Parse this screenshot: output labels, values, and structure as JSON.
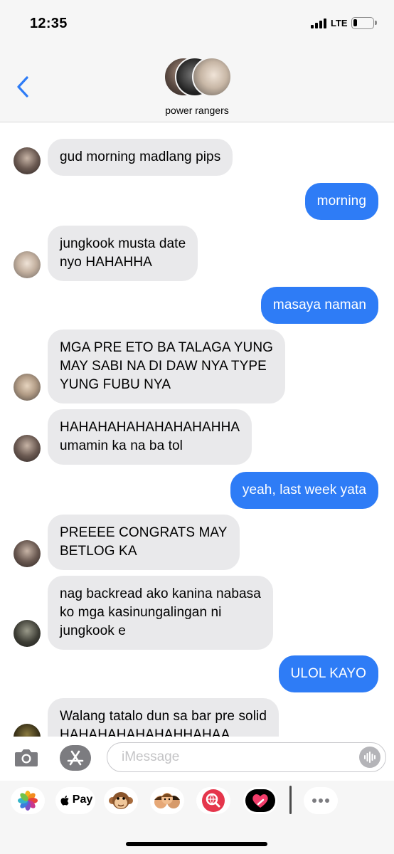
{
  "status_bar": {
    "time": "12:35",
    "network": "LTE",
    "battery_percent": 20
  },
  "header": {
    "group_name": "power rangers",
    "back_icon": "chevron-left-icon"
  },
  "messages": [
    {
      "sender": "them",
      "lines": [
        "gud morning madlang pips"
      ]
    },
    {
      "sender": "me",
      "lines": [
        "morning"
      ]
    },
    {
      "sender": "them",
      "lines": [
        "jungkook musta date",
        "nyo HAHAHHA"
      ]
    },
    {
      "sender": "me",
      "lines": [
        "masaya naman"
      ]
    },
    {
      "sender": "them",
      "lines": [
        "MGA PRE ETO BA TALAGA YUNG",
        "MAY SABI NA DI DAW NYA TYPE",
        "YUNG FUBU NYA"
      ]
    },
    {
      "sender": "them",
      "lines": [
        "HAHAHAHAHAHAHAHAHHA",
        "umamin ka na ba tol"
      ]
    },
    {
      "sender": "me",
      "lines": [
        "yeah, last week yata"
      ]
    },
    {
      "sender": "them",
      "lines": [
        "PREEEE CONGRATS MAY",
        "BETLOG KA"
      ]
    },
    {
      "sender": "them",
      "lines": [
        "nag backread ako kanina nabasa",
        "ko mga kasinungalingan ni",
        "jungkook e"
      ]
    },
    {
      "sender": "me",
      "lines": [
        "ULOL KAYO"
      ]
    },
    {
      "sender": "them",
      "lines": [
        "Walang tatalo dun sa bar pre solid",
        "HAHAHAHAHAHAHHAHAA"
      ]
    }
  ],
  "input_bar": {
    "camera_icon": "camera-icon",
    "apps_icon": "app-store-icon",
    "placeholder": "iMessage",
    "value": "",
    "audio_icon": "audio-waveform-icon"
  },
  "app_drawer": {
    "apps": [
      {
        "name": "photos-icon"
      },
      {
        "name": "apple-pay",
        "label": "Pay"
      },
      {
        "name": "monkey-emoji-icon"
      },
      {
        "name": "memoji-icon"
      },
      {
        "name": "web-search-icon"
      },
      {
        "name": "digital-touch-heart-icon"
      },
      {
        "name": "more-icon"
      }
    ]
  }
}
